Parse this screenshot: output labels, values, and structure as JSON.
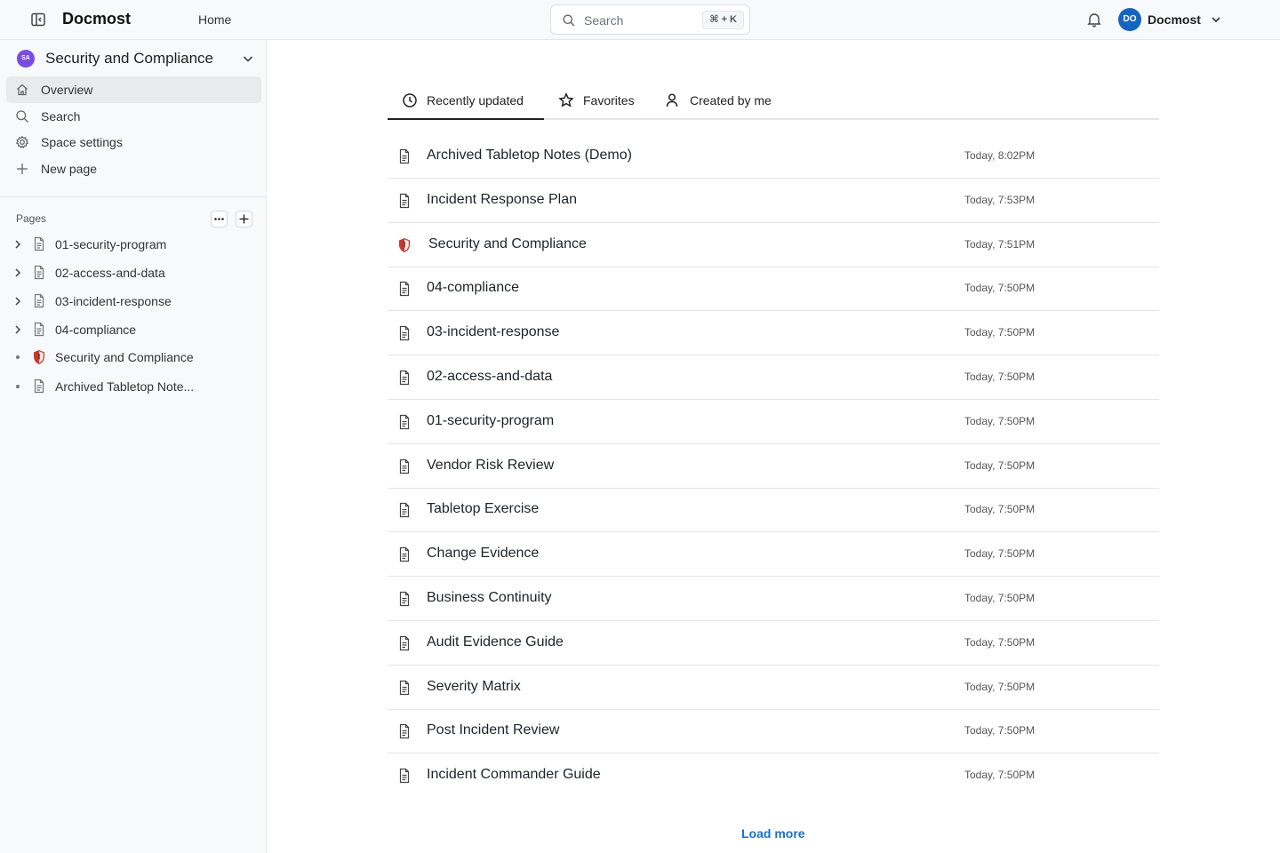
{
  "header": {
    "app_name": "Docmost",
    "home_label": "Home",
    "search_label": "Search",
    "search_shortcut": "⌘ + K",
    "user_initials": "DO",
    "user_name": "Docmost"
  },
  "sidebar": {
    "space": {
      "initials": "SA",
      "name": "Security and Compliance",
      "avatar_color": "#7b4ce0"
    },
    "nav": [
      {
        "label": "Overview",
        "icon": "home-icon",
        "active": true
      },
      {
        "label": "Search",
        "icon": "search-icon"
      },
      {
        "label": "Space settings",
        "icon": "gear-icon"
      },
      {
        "label": "New page",
        "icon": "plus-icon"
      }
    ],
    "pages_label": "Pages",
    "tree": [
      {
        "label": "01-security-program",
        "icon": "page-icon",
        "expandable": true
      },
      {
        "label": "02-access-and-data",
        "icon": "page-icon",
        "expandable": true
      },
      {
        "label": "03-incident-response",
        "icon": "page-icon",
        "expandable": true
      },
      {
        "label": "04-compliance",
        "icon": "page-icon",
        "expandable": true
      },
      {
        "label": "Security and Compliance",
        "icon": "shield-icon",
        "expandable": false
      },
      {
        "label": "Archived Tabletop Note...",
        "icon": "page-icon",
        "expandable": false
      }
    ]
  },
  "tabs": [
    {
      "label": "Recently updated",
      "icon": "clock-icon",
      "active": true
    },
    {
      "label": "Favorites",
      "icon": "star-icon"
    },
    {
      "label": "Created by me",
      "icon": "user-icon"
    }
  ],
  "recent_pages": [
    {
      "title": "Archived Tabletop Notes (Demo)",
      "time": "Today, 8:02PM",
      "icon": "page-icon"
    },
    {
      "title": "Incident Response Plan",
      "time": "Today, 7:53PM",
      "icon": "page-icon"
    },
    {
      "title": "Security and Compliance",
      "time": "Today, 7:51PM",
      "icon": "shield-icon"
    },
    {
      "title": "04-compliance",
      "time": "Today, 7:50PM",
      "icon": "page-icon"
    },
    {
      "title": "03-incident-response",
      "time": "Today, 7:50PM",
      "icon": "page-icon"
    },
    {
      "title": "02-access-and-data",
      "time": "Today, 7:50PM",
      "icon": "page-icon"
    },
    {
      "title": "01-security-program",
      "time": "Today, 7:50PM",
      "icon": "page-icon"
    },
    {
      "title": "Vendor Risk Review",
      "time": "Today, 7:50PM",
      "icon": "page-icon"
    },
    {
      "title": "Tabletop Exercise",
      "time": "Today, 7:50PM",
      "icon": "page-icon"
    },
    {
      "title": "Change Evidence",
      "time": "Today, 7:50PM",
      "icon": "page-icon"
    },
    {
      "title": "Business Continuity",
      "time": "Today, 7:50PM",
      "icon": "page-icon"
    },
    {
      "title": "Audit Evidence Guide",
      "time": "Today, 7:50PM",
      "icon": "page-icon"
    },
    {
      "title": "Severity Matrix",
      "time": "Today, 7:50PM",
      "icon": "page-icon"
    },
    {
      "title": "Post Incident Review",
      "time": "Today, 7:50PM",
      "icon": "page-icon"
    },
    {
      "title": "Incident Commander Guide",
      "time": "Today, 7:50PM",
      "icon": "page-icon"
    }
  ],
  "load_more_label": "Load more",
  "colors": {
    "accent": "#1971c2",
    "avatar_user": "#1565c0"
  }
}
